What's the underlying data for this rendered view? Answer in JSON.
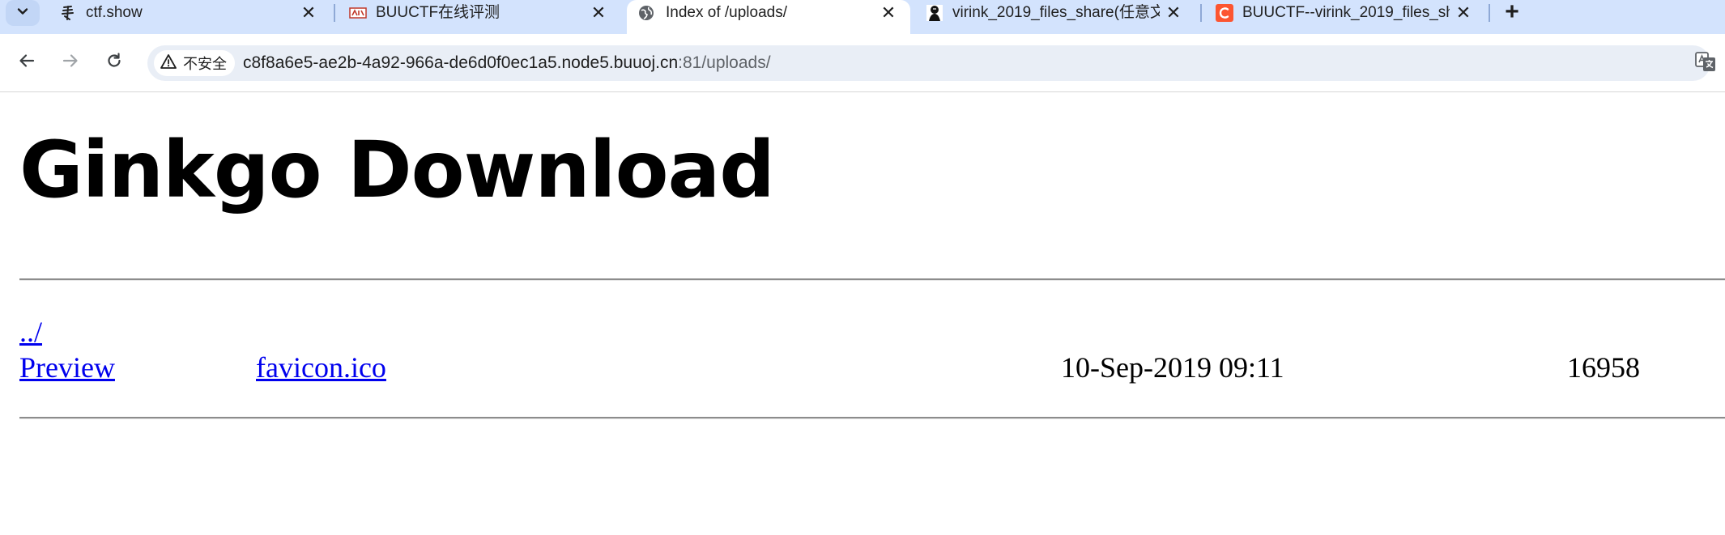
{
  "tabs": [
    {
      "title": "ctf.show",
      "favicon": "ctfshow-icon"
    },
    {
      "title": "BUUCTF在线评测",
      "favicon": "buuctf-icon"
    },
    {
      "title": "Index of /uploads/",
      "favicon": "globe-icon",
      "active": true
    },
    {
      "title": "virink_2019_files_share(任意文",
      "favicon": "virink-icon"
    },
    {
      "title": "BUUCTF--virink_2019_files_sh",
      "favicon": "csdn-icon"
    }
  ],
  "toolbar": {
    "security_label": "不安全",
    "url_host": "c8f8a6e5-ae2b-4a92-966a-de6d0f0ec1a5.node5.buuoj.cn",
    "url_rest": ":81/uploads/"
  },
  "page": {
    "heading": "Ginkgo Download",
    "parent_link": "../",
    "rows": [
      {
        "preview": "Preview",
        "name": "favicon.ico",
        "date": "10-Sep-2019 09:11",
        "size": "16958"
      }
    ]
  },
  "colors": {
    "tabstrip": "#d3e3fd",
    "omnibox": "#e9eef6",
    "link": "#0000ee",
    "csdn_red": "#fc5531"
  }
}
